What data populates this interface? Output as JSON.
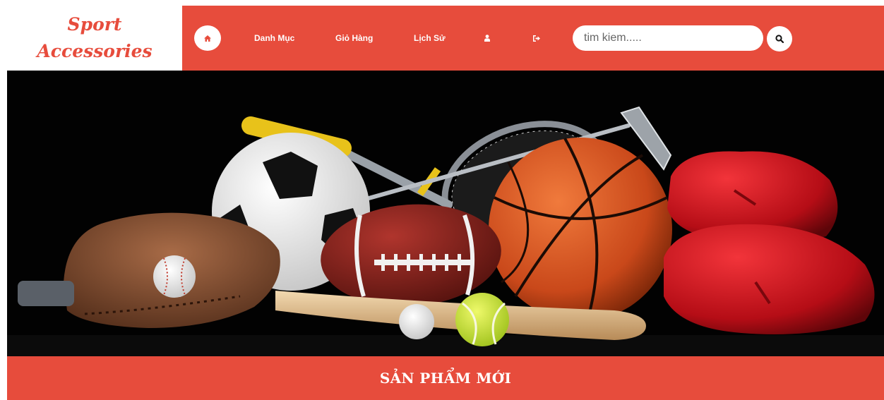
{
  "logo": {
    "line1": "Sport",
    "line2": "Accessories"
  },
  "nav": {
    "home_icon": "home-icon",
    "items": [
      {
        "label": "Danh Mục"
      },
      {
        "label": "Giỏ Hàng"
      },
      {
        "label": "Lịch Sử"
      }
    ],
    "user_icon": "user-icon",
    "logout_icon": "sign-out-icon"
  },
  "search": {
    "placeholder": "tim kiem.....",
    "value": "",
    "button_icon": "search-icon"
  },
  "banner": {
    "image": "sports-equipment-banner"
  },
  "section": {
    "title": "SẢN PHẨM MỚI"
  },
  "colors": {
    "accent": "#e74c3c",
    "white": "#ffffff",
    "banner_bg": "#020202"
  }
}
